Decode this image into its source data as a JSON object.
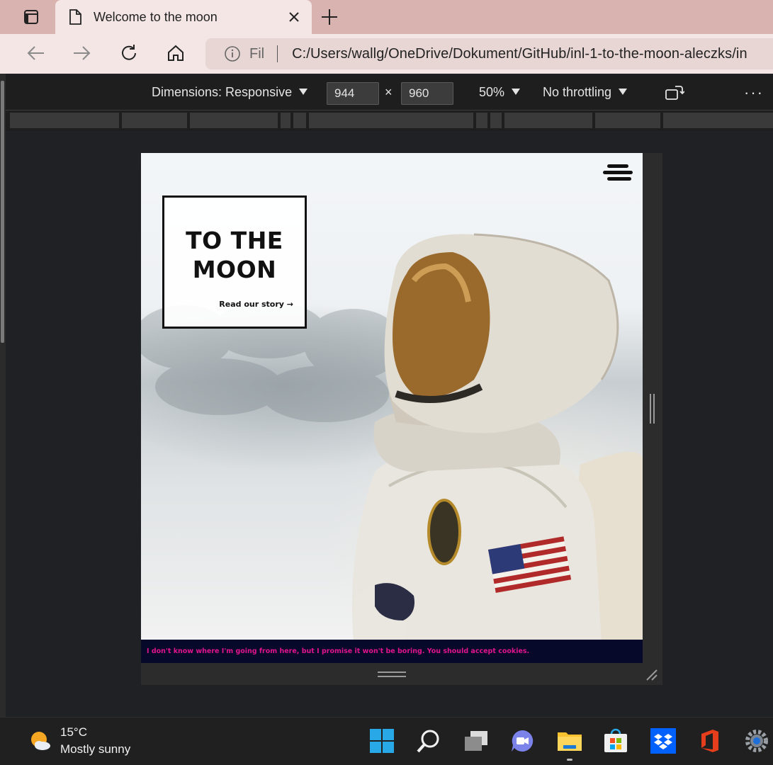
{
  "browser": {
    "tab_title": "Welcome to the moon",
    "address_prefix": "Fil",
    "url": "C:/Users/wallg/OneDrive/Dokument/GitHub/inl-1-to-the-moon-aleczks/in"
  },
  "devtools": {
    "dimensions_label": "Dimensions: Responsive",
    "width": "944",
    "times": "×",
    "height": "960",
    "zoom": "50%",
    "throttling": "No throttling",
    "more": "···"
  },
  "page": {
    "title_line1": "TO THE",
    "title_line2": "MOON",
    "read_story": "Read our story →",
    "cookie_text": "I don't know where I'm going from here, but I promise it won't be boring. You should accept cookies."
  },
  "taskbar": {
    "temperature": "15°C",
    "condition": "Mostly sunny",
    "apps": [
      "start-icon",
      "search-icon",
      "task-view-icon",
      "chat-icon",
      "file-explorer-icon",
      "store-icon",
      "dropbox-icon",
      "office-icon",
      "settings-icon"
    ]
  },
  "colors": {
    "tabstrip": "#d9b3b0",
    "cookie_bg": "#06092a",
    "cookie_text": "#e0148c"
  }
}
